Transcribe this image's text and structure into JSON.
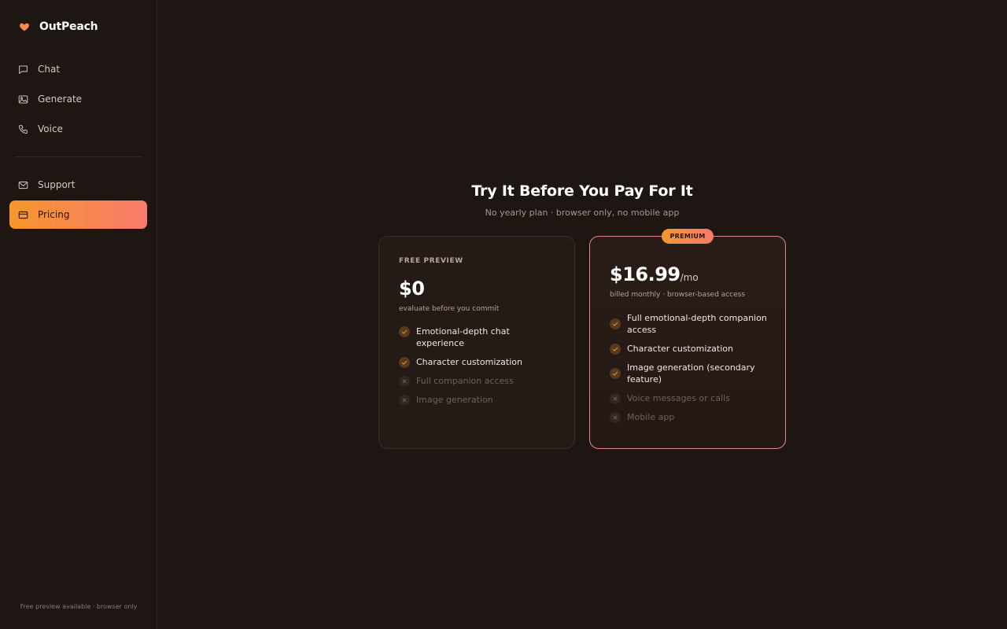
{
  "brand": {
    "name": "OutPeach"
  },
  "colors": {
    "accent_start": "#f7972b",
    "accent_end": "#f77a6e",
    "background": "#1e1613",
    "premium_border": "#e8858a"
  },
  "sidebar": {
    "items": [
      {
        "label": "Chat",
        "icon": "chat-bubble-icon"
      },
      {
        "label": "Generate",
        "icon": "image-icon"
      },
      {
        "label": "Voice",
        "icon": "phone-icon"
      },
      {
        "label": "Support",
        "icon": "mail-icon"
      },
      {
        "label": "Pricing",
        "icon": "credit-card-icon",
        "active": true
      }
    ],
    "footer": "Free preview available · browser only"
  },
  "main": {
    "title": "Try It Before You Pay For It",
    "subtitle": "No yearly plan · browser only, no mobile app"
  },
  "plans": {
    "free": {
      "name": "FREE PREVIEW",
      "price": "$0",
      "note": "evaluate before you commit",
      "features": [
        {
          "label": "Emotional-depth chat experience",
          "included": true
        },
        {
          "label": "Character customization",
          "included": true
        },
        {
          "label": "Full companion access",
          "included": false
        },
        {
          "label": "Image generation",
          "included": false
        }
      ]
    },
    "premium": {
      "badge": "PREMIUM",
      "price": "$16.99",
      "unit": "/mo",
      "note": "billed monthly · browser-based access",
      "features": [
        {
          "label": "Full emotional-depth companion access",
          "included": true
        },
        {
          "label": "Character customization",
          "included": true
        },
        {
          "label": "Image generation (secondary feature)",
          "included": true
        },
        {
          "label": "Voice messages or calls",
          "included": false
        },
        {
          "label": "Mobile app",
          "included": false
        }
      ]
    }
  }
}
